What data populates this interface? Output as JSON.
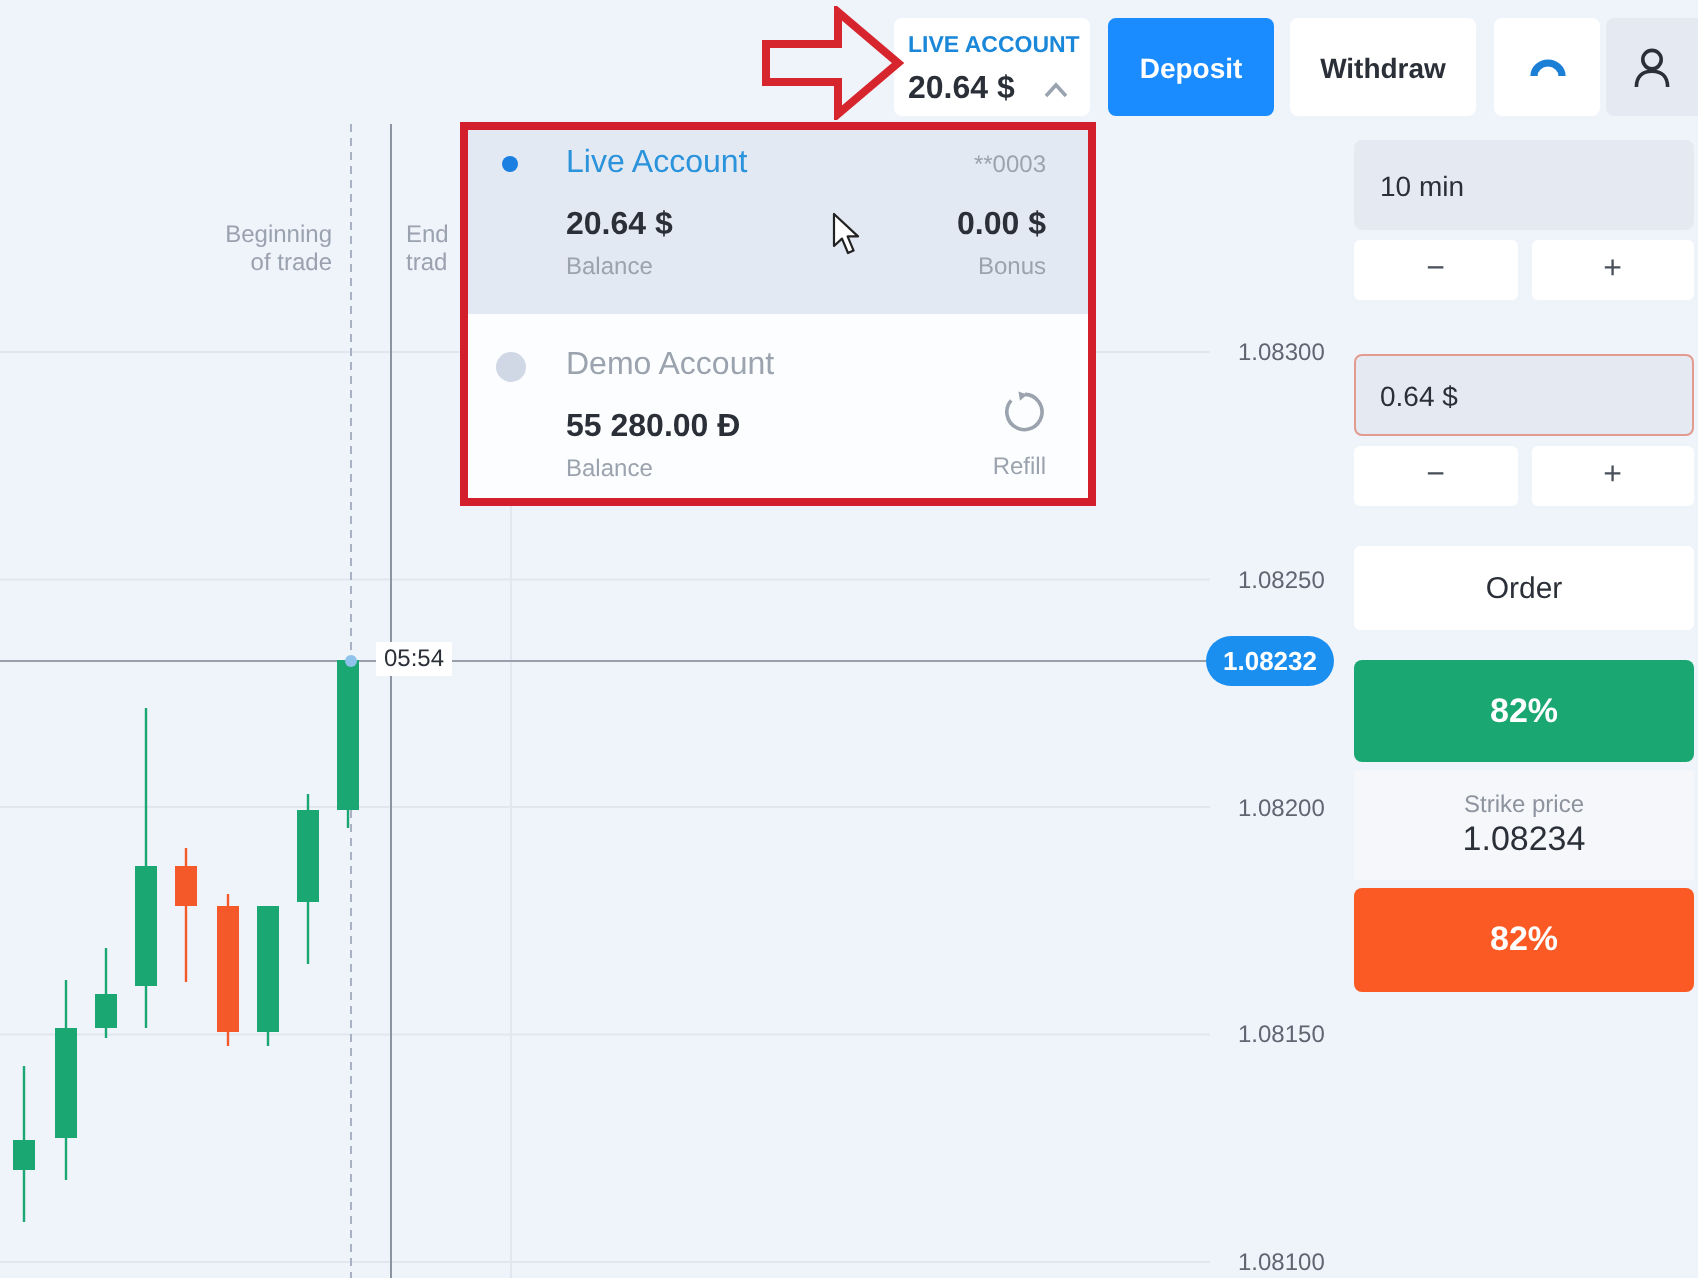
{
  "header": {
    "account_switcher": {
      "label": "LIVE ACCOUNT",
      "balance": "20.64 $",
      "expanded": true
    },
    "buttons": [
      {
        "kind": "deposit",
        "label": "Deposit"
      },
      {
        "kind": "withdraw",
        "label": "Withdraw"
      }
    ]
  },
  "account_dropdown": {
    "accounts": [
      {
        "kind": "live",
        "name": "Live Account",
        "selected": true,
        "number": "**0003",
        "balance": "20.64 $",
        "balance_label": "Balance",
        "bonus": "0.00 $",
        "bonus_label": "Bonus"
      },
      {
        "kind": "demo",
        "name": "Demo Account",
        "selected": false,
        "balance": "55 280.00 Đ",
        "balance_label": "Balance",
        "refill_label": "Refill"
      }
    ]
  },
  "chart": {
    "trade_labels": [
      {
        "kind": "start",
        "text": "Beginning of trade"
      },
      {
        "kind": "end",
        "text": "End trad"
      }
    ],
    "timer": "05:54",
    "current_price": "1.08232",
    "price_axis": [
      "1.08300",
      "1.08250",
      "1.08200",
      "1.08150",
      "1.08100"
    ]
  },
  "trade_panel": {
    "duration": {
      "value": "10 min",
      "buttons": [
        "−",
        "+"
      ]
    },
    "amount": {
      "value": "0.64 $",
      "error": true,
      "buttons": [
        "−",
        "+"
      ]
    },
    "order_label": "Order",
    "up_button": {
      "label": "82%"
    },
    "strike": {
      "label": "Strike price",
      "value": "1.08234"
    },
    "down_button": {
      "label": "82%"
    }
  }
}
